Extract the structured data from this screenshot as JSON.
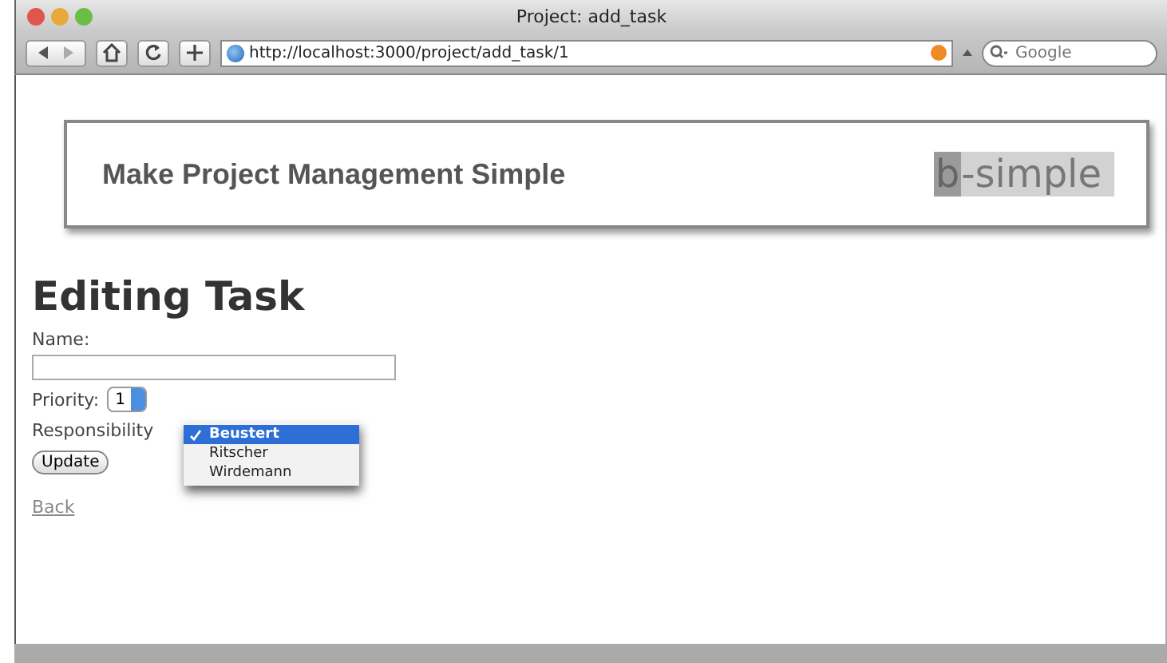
{
  "window": {
    "title": "Project: add_task"
  },
  "toolbar": {
    "url": "http://localhost:3000/project/add_task/1",
    "search": {
      "placeholder": "Google"
    }
  },
  "banner": {
    "tagline": "Make Project Management Simple",
    "logo": {
      "mark": "b",
      "text": "-simple"
    }
  },
  "form": {
    "heading": "Editing Task",
    "name": {
      "label": "Name:"
    },
    "priority": {
      "label": "Priority:",
      "value": "1"
    },
    "responsibility": {
      "label": "Responsibility",
      "options": [
        {
          "label": "Beustert",
          "selected": true
        },
        {
          "label": "Ritscher",
          "selected": false
        },
        {
          "label": "Wirdemann",
          "selected": false
        }
      ]
    },
    "submit": "Update",
    "back": "Back"
  }
}
